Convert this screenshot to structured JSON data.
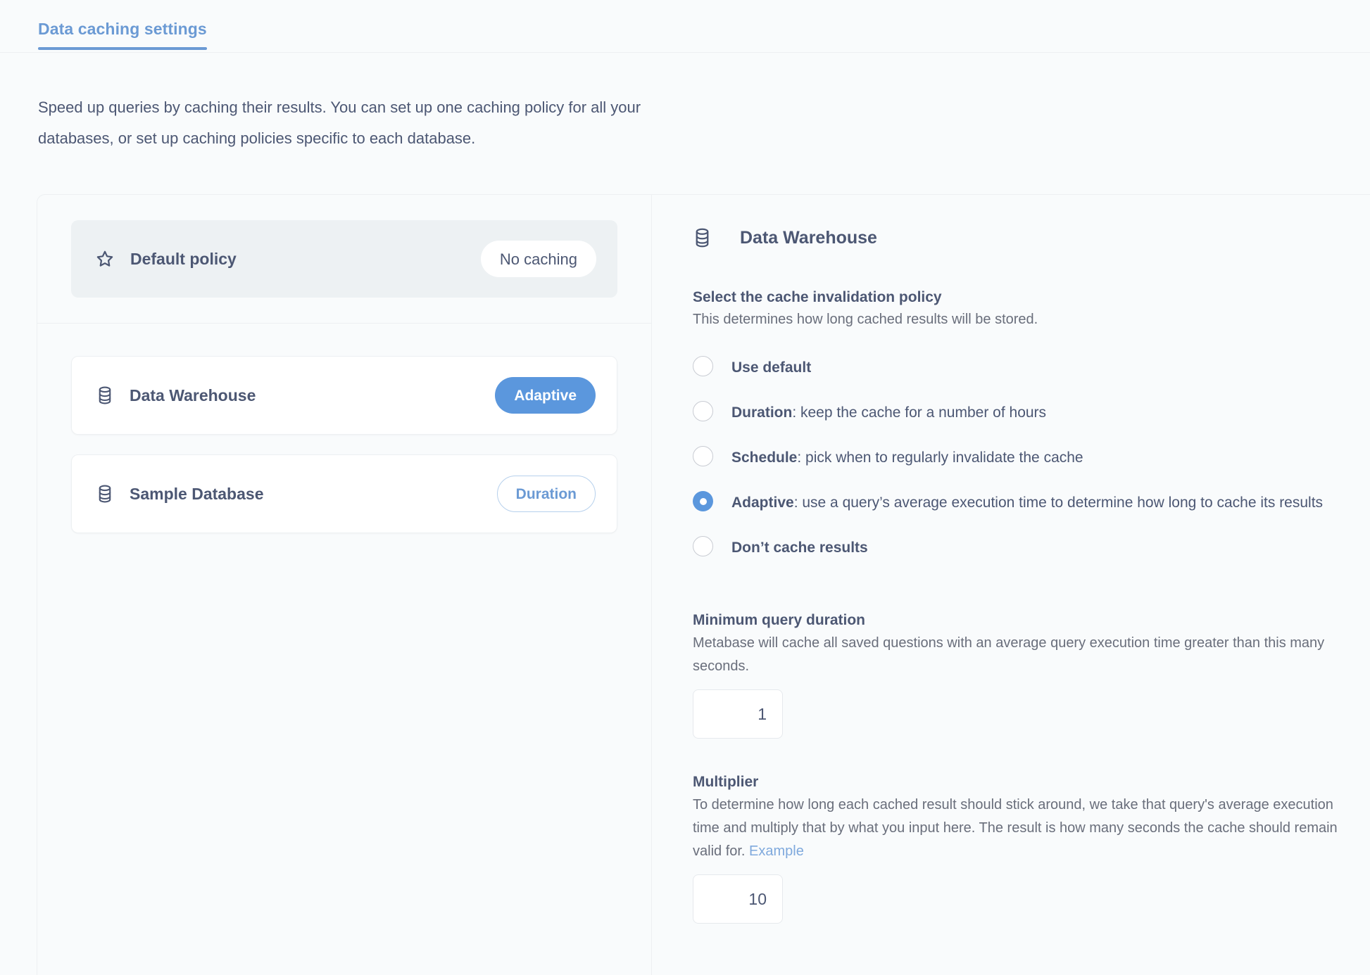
{
  "tab": {
    "label": "Data caching settings"
  },
  "intro": {
    "text": "Speed up queries by caching their results. You can set up one caching policy for all your databases, or set up caching policies specific to each database."
  },
  "left_pane": {
    "default_policy": {
      "label": "Default policy",
      "icon": "star-icon",
      "pill": "No caching"
    },
    "databases": [
      {
        "label": "Data Warehouse",
        "icon": "database-icon",
        "pill": "Adaptive",
        "pill_style": "filled"
      },
      {
        "label": "Sample Database",
        "icon": "database-icon",
        "pill": "Duration",
        "pill_style": "outline"
      }
    ]
  },
  "right_pane": {
    "header": {
      "title": "Data Warehouse",
      "icon": "database-icon"
    },
    "policy_section": {
      "title": "Select the cache invalidation policy",
      "subtitle": "This determines how long cached results will be stored."
    },
    "options": [
      {
        "bold": "Use default",
        "rest": "",
        "checked": false
      },
      {
        "bold": "Duration",
        "rest": ": keep the cache for a number of hours",
        "checked": false
      },
      {
        "bold": "Schedule",
        "rest": ": pick when to regularly invalidate the cache",
        "checked": false
      },
      {
        "bold": "Adaptive",
        "rest": ": use a query’s average execution time to determine how long to cache its results",
        "checked": true
      },
      {
        "bold": "Don’t cache results",
        "rest": "",
        "checked": false
      }
    ],
    "min_duration": {
      "title": "Minimum query duration",
      "description": "Metabase will cache all saved questions with an average query execution time greater than this many seconds.",
      "value": "1"
    },
    "multiplier": {
      "title": "Multiplier",
      "description": "To determine how long each cached result should stick around, we take that query's average execution time and multiply that by what you input here. The result is how many seconds the cache should remain valid for.",
      "link": "Example",
      "value": "10"
    }
  },
  "colors": {
    "accent": "#5b97dd",
    "tab": "#6b9ad4",
    "text": "#4c5773",
    "muted": "#696e7b",
    "page_bg": "#f9fbfc",
    "card_bg": "#edf1f3",
    "border": "#edf0f2"
  }
}
